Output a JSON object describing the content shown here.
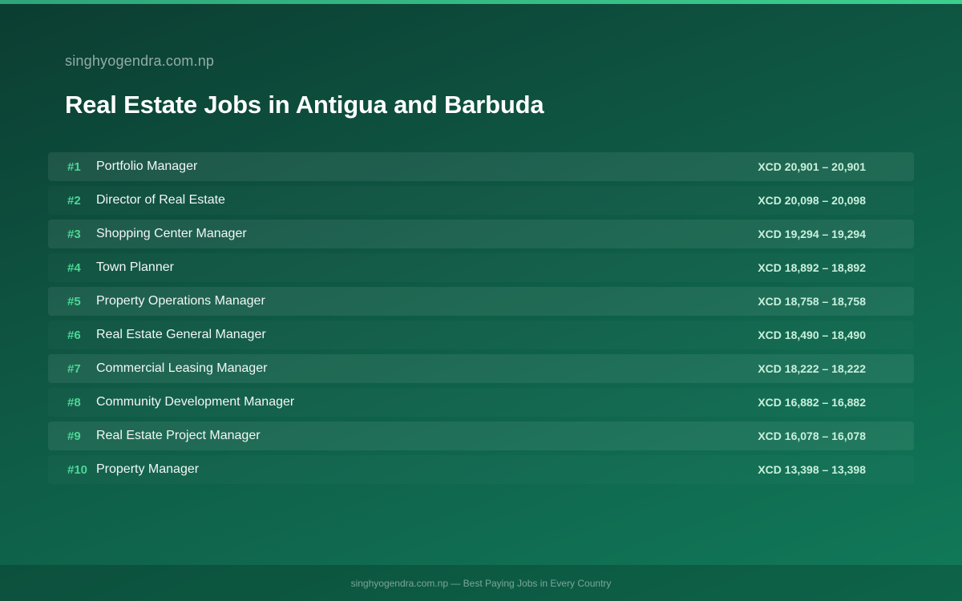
{
  "header": {
    "site": "singhyogendra.com.np",
    "title": "Real Estate Jobs in Antigua and Barbuda"
  },
  "colors": {
    "accent": "#4cd696",
    "top_bar": "#3ccf8e",
    "background_start": "#0b3d31",
    "background_end": "#107a59"
  },
  "jobs": [
    {
      "rank": "#1",
      "title": "Portfolio Manager",
      "salary": "XCD 20,901 – 20,901"
    },
    {
      "rank": "#2",
      "title": "Director of Real Estate",
      "salary": "XCD 20,098 – 20,098"
    },
    {
      "rank": "#3",
      "title": "Shopping Center Manager",
      "salary": "XCD 19,294 – 19,294"
    },
    {
      "rank": "#4",
      "title": "Town Planner",
      "salary": "XCD 18,892 – 18,892"
    },
    {
      "rank": "#5",
      "title": "Property Operations Manager",
      "salary": "XCD 18,758 – 18,758"
    },
    {
      "rank": "#6",
      "title": "Real Estate General Manager",
      "salary": "XCD 18,490 – 18,490"
    },
    {
      "rank": "#7",
      "title": "Commercial Leasing Manager",
      "salary": "XCD 18,222 – 18,222"
    },
    {
      "rank": "#8",
      "title": "Community Development Manager",
      "salary": "XCD 16,882 – 16,882"
    },
    {
      "rank": "#9",
      "title": "Real Estate Project Manager",
      "salary": "XCD 16,078 – 16,078"
    },
    {
      "rank": "#10",
      "title": "Property Manager",
      "salary": "XCD 13,398 – 13,398"
    }
  ],
  "footer": {
    "text": "singhyogendra.com.np — Best Paying Jobs in Every Country"
  }
}
